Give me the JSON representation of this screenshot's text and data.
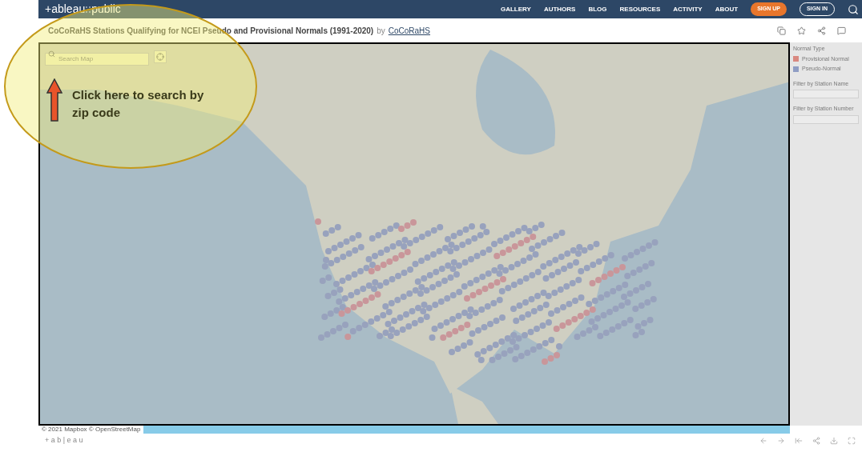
{
  "header": {
    "logo_left": "+ableau",
    "logo_right": "public",
    "nav": [
      "GALLERY",
      "AUTHORS",
      "BLOG",
      "RESOURCES",
      "ACTIVITY",
      "ABOUT"
    ],
    "sign_up": "SIGN UP",
    "sign_in": "SIGN IN"
  },
  "title_bar": {
    "title": "CoCoRaHS Stations Qualifying for NCEI Pseudo and Provisional Normals (1991-2020)",
    "by": "by",
    "author": "CoCoRaHS"
  },
  "map": {
    "search": {
      "placeholder": "Search Map"
    },
    "attribution": "© 2021 Mapbox  © OpenStreetMap"
  },
  "legend": {
    "title": "Normal Type",
    "items": [
      {
        "label": "Provisional Normal",
        "color": "#d98880"
      },
      {
        "label": "Pseudo-Normal",
        "color": "#8f9dc4"
      }
    ]
  },
  "filters": [
    {
      "label": "Filter by Station Name"
    },
    {
      "label": "Filter by Station Number"
    }
  ],
  "annotation": {
    "text": "Click here to search by zip code"
  },
  "footer": {
    "logo": "+ a b | e a u"
  }
}
